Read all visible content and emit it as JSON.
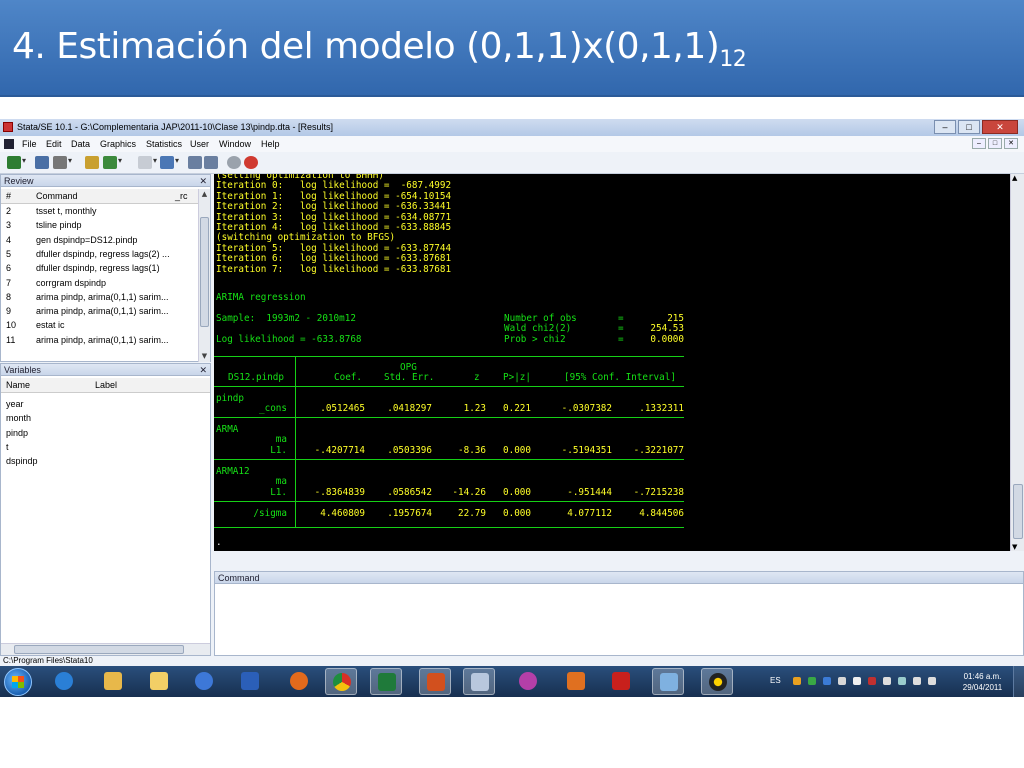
{
  "slide": {
    "title": "4. Estimación del modelo (0,1,1)x(0,1,1)",
    "title_subscript": "12"
  },
  "window": {
    "title": "Stata/SE 10.1 - G:\\Complementaria JAP\\2011-10\\Clase 13\\pindp.dta - [Results]"
  },
  "menu": [
    "File",
    "Edit",
    "Data",
    "Graphics",
    "Statistics",
    "User",
    "Window",
    "Help"
  ],
  "review": {
    "header": "Review",
    "col_num": "#",
    "col_command": "Command",
    "col_rc": "_rc",
    "rows": [
      {
        "n": "2",
        "cmd": "tsset t, monthly"
      },
      {
        "n": "3",
        "cmd": "tsline pindp"
      },
      {
        "n": "4",
        "cmd": "gen dspindp=DS12.pindp"
      },
      {
        "n": "5",
        "cmd": "dfuller dspindp, regress lags(2) ..."
      },
      {
        "n": "6",
        "cmd": "dfuller dspindp, regress lags(1)"
      },
      {
        "n": "7",
        "cmd": "corrgram dspindp"
      },
      {
        "n": "8",
        "cmd": "arima pindp, arima(0,1,1) sarim..."
      },
      {
        "n": "9",
        "cmd": "arima pindp, arima(0,1,1) sarim..."
      },
      {
        "n": "10",
        "cmd": "estat ic"
      },
      {
        "n": "11",
        "cmd": "arima pindp, arima(0,1,1) sarim..."
      }
    ]
  },
  "variables": {
    "header": "Variables",
    "col_name": "Name",
    "col_label": "Label",
    "rows": [
      "year",
      "month",
      "pindp",
      "t",
      "dspindp"
    ]
  },
  "results": {
    "iterations": [
      "(setting optimization to BHHH)",
      "Iteration 0:   log likelihood =  -687.4992",
      "Iteration 1:   log likelihood = -654.10154",
      "Iteration 2:   log likelihood = -636.33441",
      "Iteration 3:   log likelihood = -634.08771",
      "Iteration 4:   log likelihood = -633.88845",
      "(switching optimization to BFGS)",
      "Iteration 5:   log likelihood = -633.87744",
      "Iteration 6:   log likelihood = -633.87681",
      "Iteration 7:   log likelihood = -633.87681"
    ],
    "model_title": "ARIMA regression",
    "sample": "Sample:  1993m2 - 2010m12",
    "loglik": "Log likelihood = -633.8768",
    "stats": [
      {
        "label": "Number of obs",
        "eq": "=",
        "value": "215"
      },
      {
        "label": "Wald chi2(2)",
        "eq": "=",
        "value": "254.53"
      },
      {
        "label": "Prob > chi2",
        "eq": "=",
        "value": "0.0000"
      }
    ],
    "table_header_top": "OPG",
    "depvar": "DS12.pindp",
    "columns": [
      "Coef.",
      "Std. Err.",
      "z",
      "P>|z|",
      "[95% Conf. Interval]"
    ],
    "sections": [
      {
        "name": "pindp",
        "sub": "",
        "rows": [
          {
            "label": "_cons",
            "coef": ".0512465",
            "se": ".0418297",
            "z": "1.23",
            "p": "0.221",
            "lo": "-.0307382",
            "hi": ".1332311"
          }
        ]
      },
      {
        "name": "ARMA",
        "sub": "ma",
        "rows": [
          {
            "label": "L1.",
            "coef": "-.4207714",
            "se": ".0503396",
            "z": "-8.36",
            "p": "0.000",
            "lo": "-.5194351",
            "hi": "-.3221077"
          }
        ]
      },
      {
        "name": "ARMA12",
        "sub": "ma",
        "rows": [
          {
            "label": "L1.",
            "coef": "-.8364839",
            "se": ".0586542",
            "z": "-14.26",
            "p": "0.000",
            "lo": "-.951444",
            "hi": "-.7215238"
          }
        ]
      }
    ],
    "sigma": {
      "label": "/sigma",
      "coef": "4.460809",
      "se": ".1957674",
      "z": "22.79",
      "p": "0.000",
      "lo": "4.077112",
      "hi": "4.844506"
    },
    "prompt": "."
  },
  "command": {
    "header": "Command",
    "value": ""
  },
  "status": {
    "path": "C:\\Program Files\\Stata10"
  },
  "taskbar": {
    "lang": "ES",
    "time": "01:46 a.m.",
    "date": "29/04/2011"
  }
}
